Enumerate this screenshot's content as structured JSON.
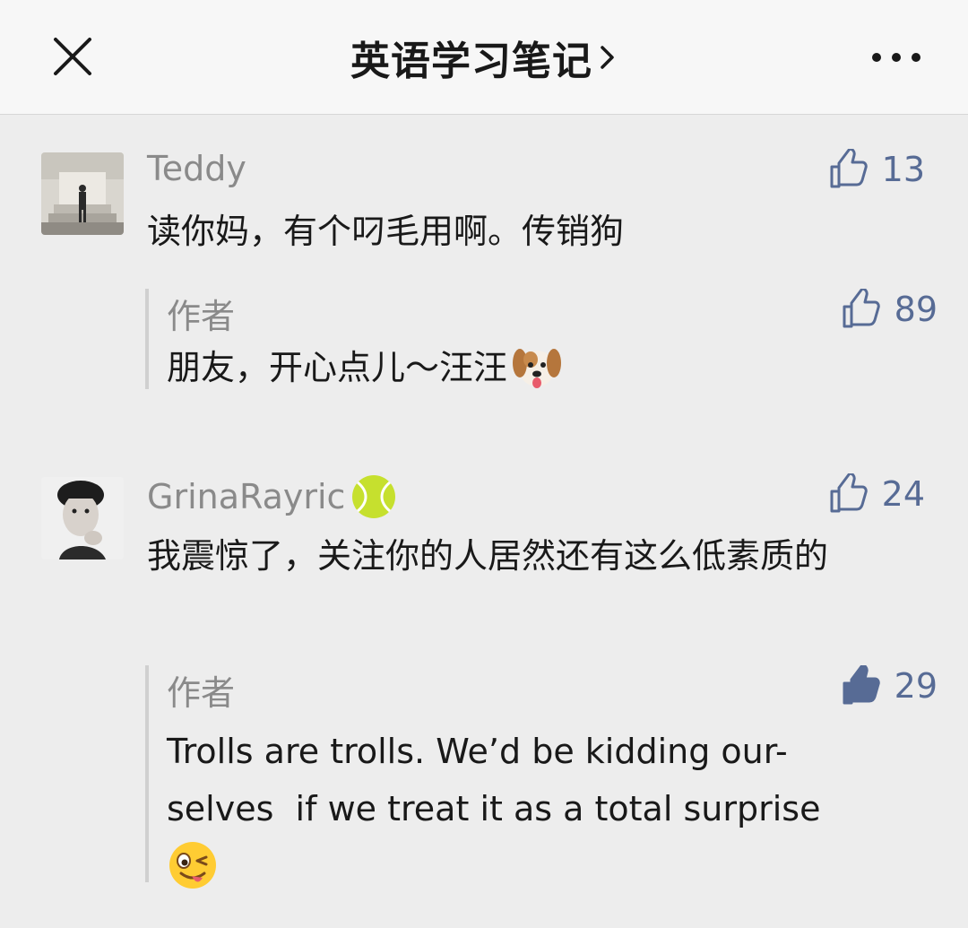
{
  "header": {
    "title": "英语学习笔记",
    "close_icon": "close-icon",
    "more_icon": "more-icon"
  },
  "comments": [
    {
      "nickname": "Teddy",
      "likes": "13",
      "text": "读你妈，有个叼毛用啊。传销狗",
      "reply": {
        "label": "作者",
        "likes": "89",
        "text": "朋友，开心点儿～汪汪",
        "emoji": "dog-face-emoji"
      }
    },
    {
      "nickname": "GrinaRayric",
      "nickname_emoji": "tennis-ball-emoji",
      "likes": "24",
      "text": "我震惊了，关注你的人居然还有这么低素质的",
      "reply": {
        "label": "作者",
        "likes": "29",
        "liked": true,
        "text_line1": "Trolls are trolls. We’d be kidding our-",
        "text_line2": "selves  if we treat it as a total surprise",
        "emoji": "winking-tongue-emoji"
      }
    }
  ],
  "colors": {
    "background": "#ededed",
    "header": "#f7f7f7",
    "link_blue": "#576b95",
    "grey_text": "#8a8a8a"
  }
}
